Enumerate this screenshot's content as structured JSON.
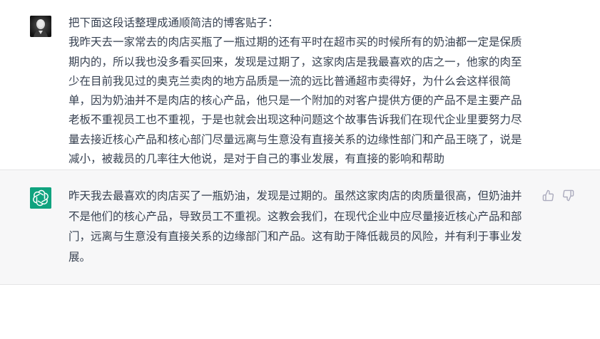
{
  "conversation": {
    "user_message": {
      "line1": "把下面这段话整理成通顺简洁的博客贴子：",
      "body": "我昨天去一家常去的肉店买瓶了一瓶过期的还有平时在超市买的时候所有的奶油都一定是保质期内的，所以我也没多看买回来，发现是过期了，这家肉店是我最喜欢的店之一，他家的肉至少在目前我见过的奥克兰卖肉的地方品质是一流的远比普通超市卖得好，为什么会这样很简单，因为奶油并不是肉店的核心产品，他只是一个附加的对客户提供方便的产品不是主要产品老板不重视员工也不重视，于是也就会出现这种问题这个故事告诉我们在现代企业里要努力尽量去接近核心产品和核心部门尽量远离与生意没有直接关系的边缘性部门和产品王晓了，说是减小，被裁员的几率往大他说，是对于自己的事业发展，有直接的影响和帮助"
    },
    "assistant_message": {
      "body": "昨天我去最喜欢的肉店买了一瓶奶油，发现是过期的。虽然这家肉店的肉质量很高，但奶油并不是他们的核心产品，导致员工不重视。这教会我们，在现代企业中应尽量接近核心产品和部门，远离与生意没有直接关系的边缘部门和产品。这有助于降低裁员的风险，并有利于事业发展。"
    }
  },
  "icons": {
    "user_avatar": "user-avatar-portrait",
    "assistant_avatar": "chatgpt-logo-icon",
    "thumbs_up": "thumbs-up-icon",
    "thumbs_down": "thumbs-down-icon"
  },
  "colors": {
    "assistant_avatar_bg": "#10a37f",
    "assistant_row_bg": "#f7f7f8",
    "text": "#374151",
    "icon_gray": "#acacbe"
  }
}
